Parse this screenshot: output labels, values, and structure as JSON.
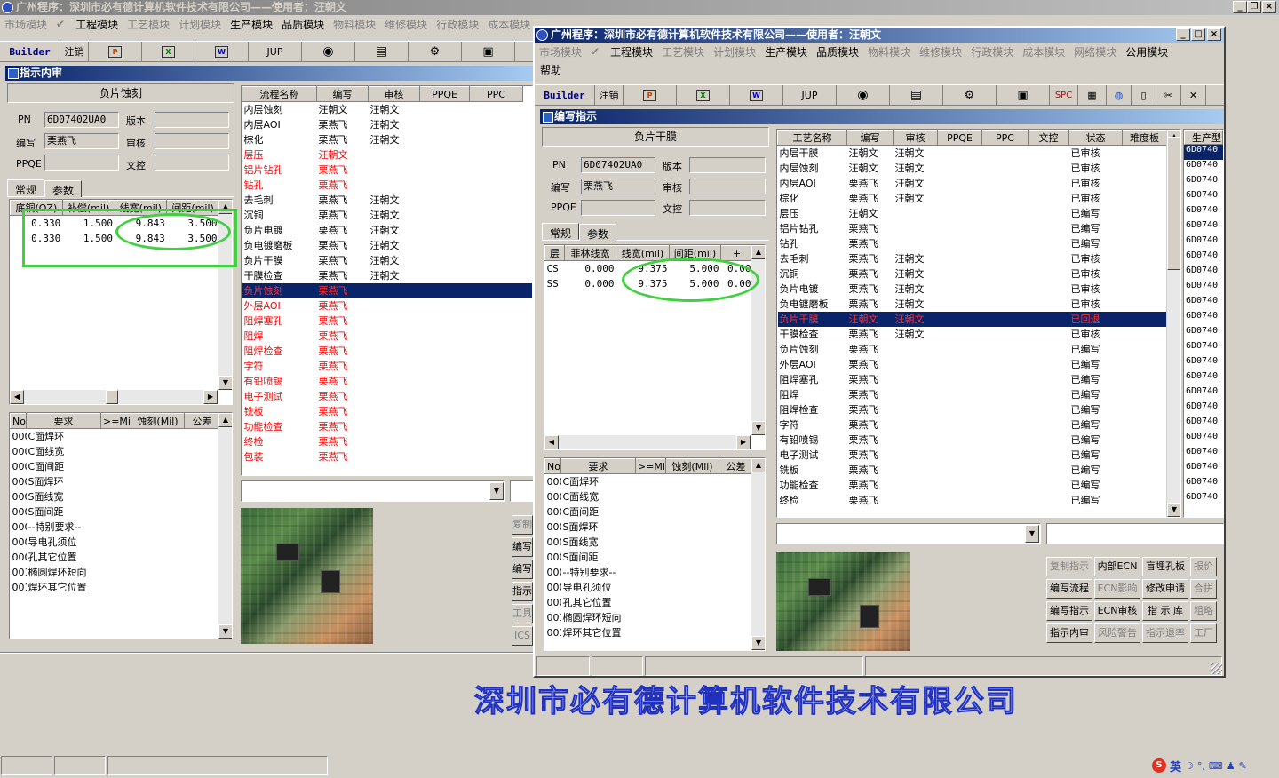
{
  "main_window": {
    "title": "广州程序：深圳市必有德计算机软件技术有限公司——使用者：汪朝文",
    "menu": [
      "市场模块",
      "工程模块",
      "工艺模块",
      "计划模块",
      "生产模块",
      "品质模块",
      "物料模块",
      "维修模块",
      "行政模块",
      "成本模块",
      "网络模块",
      "帮助"
    ],
    "toolbar": {
      "builder": "Builder",
      "logout": "注销",
      "jup": "JUP"
    }
  },
  "back_panel": {
    "title": "指示内审",
    "process": "负片蚀刻",
    "pn_label": "PN",
    "pn_value": "6D07402UA0",
    "version_label": "版本",
    "writer_label": "编写",
    "writer_value": "栗燕飞",
    "review_label": "审核",
    "ppqe_label": "PPQE",
    "doccheck_label": "文控",
    "tab_general": "常规",
    "tab_params": "参数",
    "param_headers": [
      "底铜(OZ)",
      "补偿(mil)",
      "线宽(mil)",
      "间距(mil)"
    ],
    "param_rows": [
      [
        "0.330",
        "1.500",
        "9.843",
        "3.500"
      ],
      [
        "0.330",
        "1.500",
        "9.843",
        "3.500"
      ]
    ],
    "req_headers": [
      "No",
      "要求",
      ">=Mil",
      "蚀刻(Mil)",
      "公差"
    ],
    "req_rows": [
      [
        "000",
        "C面焊环"
      ],
      [
        "000",
        "C面线宽"
      ],
      [
        "000",
        "C面间距"
      ],
      [
        "000",
        "S面焊环"
      ],
      [
        "000",
        "S面线宽"
      ],
      [
        "000",
        "S面间距"
      ],
      [
        "000",
        "--特别要求--"
      ],
      [
        "000",
        "导电孔须位"
      ],
      [
        "000",
        "孔其它位置"
      ],
      [
        "001",
        "椭圆焊环短向"
      ],
      [
        "001",
        "焊环其它位置"
      ]
    ],
    "flow_headers": [
      "流程名称",
      "编写",
      "审核",
      "PPQE",
      "PPC"
    ],
    "flow_rows": [
      {
        "n": "内层蚀刻",
        "w": "汪朝文",
        "r": "汪朝文",
        "s": "n"
      },
      {
        "n": "内层AOI",
        "w": "栗燕飞",
        "r": "汪朝文",
        "s": "n"
      },
      {
        "n": "棕化",
        "w": "栗燕飞",
        "r": "汪朝文",
        "s": "n"
      },
      {
        "n": "层压",
        "w": "汪朝文",
        "r": "",
        "s": "r"
      },
      {
        "n": "铝片钻孔",
        "w": "栗燕飞",
        "r": "",
        "s": "r"
      },
      {
        "n": "钻孔",
        "w": "栗燕飞",
        "r": "",
        "s": "r"
      },
      {
        "n": "去毛刺",
        "w": "栗燕飞",
        "r": "汪朝文",
        "s": "n"
      },
      {
        "n": "沉铜",
        "w": "栗燕飞",
        "r": "汪朝文",
        "s": "n"
      },
      {
        "n": "负片电镀",
        "w": "栗燕飞",
        "r": "汪朝文",
        "s": "n"
      },
      {
        "n": "负电镀磨板",
        "w": "栗燕飞",
        "r": "汪朝文",
        "s": "n"
      },
      {
        "n": "负片干膜",
        "w": "栗燕飞",
        "r": "汪朝文",
        "s": "n"
      },
      {
        "n": "干膜检查",
        "w": "栗燕飞",
        "r": "汪朝文",
        "s": "n"
      },
      {
        "n": "负片蚀刻",
        "w": "栗燕飞",
        "r": "",
        "s": "sel"
      },
      {
        "n": "外层AOI",
        "w": "栗燕飞",
        "r": "",
        "s": "r"
      },
      {
        "n": "阻焊塞孔",
        "w": "栗燕飞",
        "r": "",
        "s": "r"
      },
      {
        "n": "阻焊",
        "w": "栗燕飞",
        "r": "",
        "s": "r"
      },
      {
        "n": "阻焊检查",
        "w": "栗燕飞",
        "r": "",
        "s": "r"
      },
      {
        "n": "字符",
        "w": "栗燕飞",
        "r": "",
        "s": "r"
      },
      {
        "n": "有铅喷锡",
        "w": "栗燕飞",
        "r": "",
        "s": "r"
      },
      {
        "n": "电子测试",
        "w": "栗燕飞",
        "r": "",
        "s": "r"
      },
      {
        "n": "铣板",
        "w": "栗燕飞",
        "r": "",
        "s": "r"
      },
      {
        "n": "功能检查",
        "w": "栗燕飞",
        "r": "",
        "s": "r"
      },
      {
        "n": "终检",
        "w": "栗燕飞",
        "r": "",
        "s": "r"
      },
      {
        "n": "包装",
        "w": "栗燕飞",
        "r": "",
        "s": "r"
      }
    ],
    "side_buttons": [
      "复制",
      "编写",
      "编写",
      "指示",
      "工具",
      "ICS"
    ]
  },
  "front_window": {
    "title": "广州程序：深圳市必有德计算机软件技术有限公司——使用者：汪朝文",
    "menu": [
      "市场模块",
      "工程模块",
      "工艺模块",
      "计划模块",
      "生产模块",
      "品质模块",
      "物料模块",
      "维修模块",
      "行政模块",
      "成本模块",
      "网络模块",
      "公用模块"
    ],
    "menu2": "帮助",
    "toolbar": {
      "builder": "Builder",
      "logout": "注销",
      "jup": "JUP",
      "spc": "SPC"
    },
    "panel_title": "编写指示",
    "process": "负片干膜",
    "pn_label": "PN",
    "pn_value": "6D07402UA0",
    "version_label": "版本",
    "writer_label": "编写",
    "writer_value": "栗燕飞",
    "review_label": "审核",
    "ppqe_label": "PPQE",
    "doccheck_label": "文控",
    "tab_general": "常规",
    "tab_params": "参数",
    "param_headers": [
      "层",
      "菲林线宽",
      "线宽(mil)",
      "间距(mil)",
      "+"
    ],
    "param_rows": [
      [
        "CS",
        "0.000",
        "9.375",
        "5.000",
        "0.00"
      ],
      [
        "SS",
        "0.000",
        "9.375",
        "5.000",
        "0.00"
      ]
    ],
    "req_headers": [
      "No",
      "要求",
      ">=Mil",
      "蚀刻(Mil)",
      "公差"
    ],
    "req_rows": [
      [
        "000",
        "C面焊环"
      ],
      [
        "000",
        "C面线宽"
      ],
      [
        "000",
        "C面间距"
      ],
      [
        "000",
        "S面焊环"
      ],
      [
        "000",
        "S面线宽"
      ],
      [
        "000",
        "S面间距"
      ],
      [
        "000",
        "--特别要求--"
      ],
      [
        "000",
        "导电孔须位"
      ],
      [
        "000",
        "孔其它位置"
      ],
      [
        "001",
        "椭圆焊环短向"
      ],
      [
        "001",
        "焊环其它位置"
      ]
    ],
    "flow_headers": [
      "工艺名称",
      "编写",
      "审核",
      "PPQE",
      "PPC",
      "文控",
      "状态",
      "难度板"
    ],
    "flow_rows": [
      {
        "n": "内层干膜",
        "w": "汪朝文",
        "r": "汪朝文",
        "st": "已审核",
        "s": "n"
      },
      {
        "n": "内层蚀刻",
        "w": "汪朝文",
        "r": "汪朝文",
        "st": "已审核",
        "s": "n"
      },
      {
        "n": "内层AOI",
        "w": "栗燕飞",
        "r": "汪朝文",
        "st": "已审核",
        "s": "n"
      },
      {
        "n": "棕化",
        "w": "栗燕飞",
        "r": "汪朝文",
        "st": "已审核",
        "s": "n"
      },
      {
        "n": "层压",
        "w": "汪朝文",
        "r": "",
        "st": "已编写",
        "s": "n"
      },
      {
        "n": "铝片钻孔",
        "w": "栗燕飞",
        "r": "",
        "st": "已编写",
        "s": "n"
      },
      {
        "n": "钻孔",
        "w": "栗燕飞",
        "r": "",
        "st": "已编写",
        "s": "n"
      },
      {
        "n": "去毛刺",
        "w": "栗燕飞",
        "r": "汪朝文",
        "st": "已审核",
        "s": "n"
      },
      {
        "n": "沉铜",
        "w": "栗燕飞",
        "r": "汪朝文",
        "st": "已审核",
        "s": "n"
      },
      {
        "n": "负片电镀",
        "w": "栗燕飞",
        "r": "汪朝文",
        "st": "已审核",
        "s": "n"
      },
      {
        "n": "负电镀磨板",
        "w": "栗燕飞",
        "r": "汪朝文",
        "st": "已审核",
        "s": "n"
      },
      {
        "n": "负片干膜",
        "w": "汪朝文",
        "r": "汪朝文",
        "st": "已回退",
        "s": "sel"
      },
      {
        "n": "干膜检查",
        "w": "栗燕飞",
        "r": "汪朝文",
        "st": "已审核",
        "s": "n"
      },
      {
        "n": "负片蚀刻",
        "w": "栗燕飞",
        "r": "",
        "st": "已编写",
        "s": "n"
      },
      {
        "n": "外层AOI",
        "w": "栗燕飞",
        "r": "",
        "st": "已编写",
        "s": "n"
      },
      {
        "n": "阻焊塞孔",
        "w": "栗燕飞",
        "r": "",
        "st": "已编写",
        "s": "n"
      },
      {
        "n": "阻焊",
        "w": "栗燕飞",
        "r": "",
        "st": "已编写",
        "s": "n"
      },
      {
        "n": "阻焊检查",
        "w": "栗燕飞",
        "r": "",
        "st": "已编写",
        "s": "n"
      },
      {
        "n": "字符",
        "w": "栗燕飞",
        "r": "",
        "st": "已编写",
        "s": "n"
      },
      {
        "n": "有铅喷锡",
        "w": "栗燕飞",
        "r": "",
        "st": "已编写",
        "s": "n"
      },
      {
        "n": "电子测试",
        "w": "栗燕飞",
        "r": "",
        "st": "已编写",
        "s": "n"
      },
      {
        "n": "铣板",
        "w": "栗燕飞",
        "r": "",
        "st": "已编写",
        "s": "n"
      },
      {
        "n": "功能检查",
        "w": "栗燕飞",
        "r": "",
        "st": "已编写",
        "s": "n"
      },
      {
        "n": "终检",
        "w": "栗燕飞",
        "r": "",
        "st": "已编写",
        "s": "n"
      }
    ],
    "prod_header": "生产型",
    "prod_value": "6D0740",
    "buttons": [
      [
        "复制指示",
        "内部ECN",
        "盲埋孔板",
        "报价"
      ],
      [
        "编写流程",
        "ECN影响",
        "修改申请",
        "合拼"
      ],
      [
        "编写指示",
        "ECN审核",
        "指 示 库",
        "粗略"
      ],
      [
        "指示内审",
        "风险警告",
        "指示退率",
        "工厂"
      ]
    ],
    "buttons_disabled": [
      [
        true,
        false,
        false,
        true
      ],
      [
        false,
        true,
        false,
        true
      ],
      [
        false,
        false,
        false,
        true
      ],
      [
        false,
        true,
        true,
        true
      ]
    ]
  },
  "watermark": "深圳市必有德计算机软件技术有限公司",
  "tray": {
    "ime": "英"
  },
  "colors": {
    "title_blue": "#0a246a",
    "selection": "#0a246a",
    "red_text": "#ff0000",
    "green_mark": "#40d040"
  }
}
